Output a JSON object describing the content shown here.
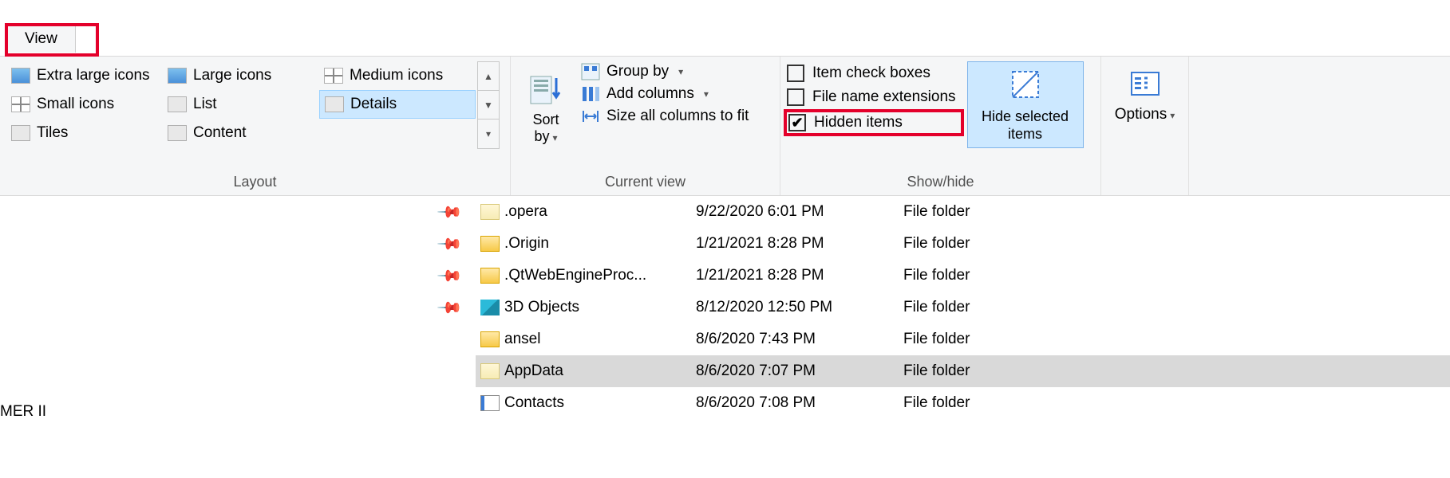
{
  "tab": {
    "label": "View"
  },
  "layout": {
    "items": [
      "Extra large icons",
      "Large icons",
      "Medium icons",
      "Small icons",
      "List",
      "Details",
      "Tiles",
      "Content",
      ""
    ],
    "selected_index": 5,
    "group_label": "Layout"
  },
  "current_view": {
    "sort_by": "Sort by",
    "group_by": "Group by",
    "add_columns": "Add columns",
    "size_all": "Size all columns to fit",
    "group_label": "Current view"
  },
  "show_hide": {
    "item_check_boxes": {
      "label": "Item check boxes",
      "checked": false
    },
    "file_name_extensions": {
      "label": "File name extensions",
      "checked": false
    },
    "hidden_items": {
      "label": "Hidden items",
      "checked": true
    },
    "hide_selected": "Hide selected items",
    "group_label": "Show/hide"
  },
  "options": {
    "label": "Options"
  },
  "nav_truncated": "MER II",
  "files": [
    {
      "name": ".opera",
      "date": "9/22/2020 6:01 PM",
      "type": "File folder",
      "icon": "pale",
      "selected": false
    },
    {
      "name": ".Origin",
      "date": "1/21/2021 8:28 PM",
      "type": "File folder",
      "icon": "yellow",
      "selected": false
    },
    {
      "name": ".QtWebEngineProc...",
      "date": "1/21/2021 8:28 PM",
      "type": "File folder",
      "icon": "yellow",
      "selected": false
    },
    {
      "name": "3D Objects",
      "date": "8/12/2020 12:50 PM",
      "type": "File folder",
      "icon": "cube",
      "selected": false
    },
    {
      "name": "ansel",
      "date": "8/6/2020 7:43 PM",
      "type": "File folder",
      "icon": "yellow",
      "selected": false
    },
    {
      "name": "AppData",
      "date": "8/6/2020 7:07 PM",
      "type": "File folder",
      "icon": "pale",
      "selected": true
    },
    {
      "name": "Contacts",
      "date": "8/6/2020 7:08 PM",
      "type": "File folder",
      "icon": "card",
      "selected": false
    }
  ]
}
